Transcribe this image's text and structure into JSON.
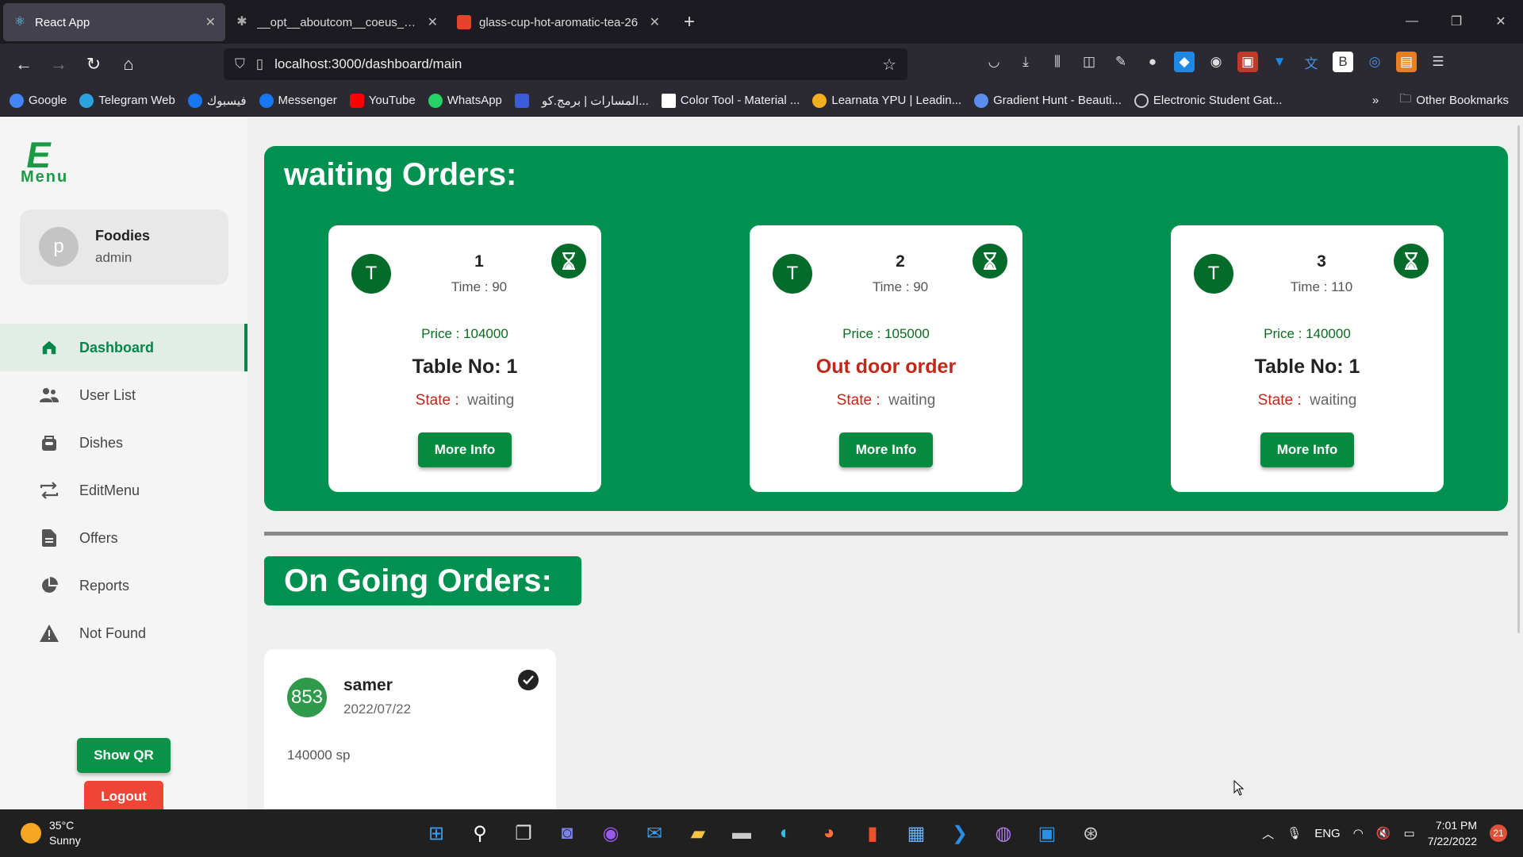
{
  "browser": {
    "tabs": [
      {
        "label": "React App",
        "color": "#61dafb",
        "active": true
      },
      {
        "label": "__opt__aboutcom__coeus__resources",
        "color": "#aaaaaa",
        "active": false
      },
      {
        "label": "glass-cup-hot-aromatic-tea-26",
        "color": "#e8412c",
        "active": false
      }
    ],
    "url": "localhost:3000/dashboard/main",
    "bookmarks": [
      {
        "label": "Google",
        "color": "#4285f4"
      },
      {
        "label": "Telegram Web",
        "color": "#2aa3de"
      },
      {
        "label": "فيسبوك",
        "color": "#1877f2"
      },
      {
        "label": "Messenger",
        "color": "#1877f2"
      },
      {
        "label": "YouTube",
        "color": "#ff0000"
      },
      {
        "label": "WhatsApp",
        "color": "#25d366"
      },
      {
        "label": "",
        "color": "#3b5bdb"
      },
      {
        "label": "المسارات | برمج.كو...",
        "color": "#2b2a33"
      },
      {
        "label": "Color Tool - Material ...",
        "color": "#ffffff"
      },
      {
        "label": "Learnata YPU | Leadin...",
        "color": "#f2b01e"
      },
      {
        "label": "Gradient Hunt - Beauti...",
        "color": "#5b8def"
      },
      {
        "label": "Electronic Student Gat...",
        "color": "#cccccc"
      }
    ],
    "other_bookmarks": "Other Bookmarks"
  },
  "sidebar": {
    "logo_big": "E",
    "logo_small": "Menu",
    "user": {
      "initial": "p",
      "name": "Foodies",
      "role": "admin"
    },
    "items": [
      {
        "label": "Dashboard",
        "icon": "home-icon",
        "active": true
      },
      {
        "label": "User List",
        "icon": "users-icon",
        "active": false
      },
      {
        "label": "Dishes",
        "icon": "dish-icon",
        "active": false
      },
      {
        "label": "EditMenu",
        "icon": "swap-icon",
        "active": false
      },
      {
        "label": "Offers",
        "icon": "document-icon",
        "active": false
      },
      {
        "label": "Reports",
        "icon": "pie-chart-icon",
        "active": false
      },
      {
        "label": "Not Found",
        "icon": "warning-icon",
        "active": false
      }
    ],
    "show_qr": "Show QR",
    "logout": "Logout"
  },
  "waiting": {
    "title": "waiting Orders:",
    "orders": [
      {
        "avatar": "T",
        "number": "1",
        "time": "Time : 90",
        "price": "Price : 104000",
        "table": "Table No: 1",
        "outdoor": false,
        "state_label": "State :",
        "state_value": "waiting",
        "more": "More Info"
      },
      {
        "avatar": "T",
        "number": "2",
        "time": "Time : 90",
        "price": "Price : 105000",
        "table": "Out door order",
        "outdoor": true,
        "state_label": "State :",
        "state_value": "waiting",
        "more": "More Info"
      },
      {
        "avatar": "T",
        "number": "3",
        "time": "Time : 110",
        "price": "Price : 140000",
        "table": "Table No: 1",
        "outdoor": false,
        "state_label": "State :",
        "state_value": "waiting",
        "more": "More Info"
      }
    ]
  },
  "ongoing": {
    "title": "On Going Orders:",
    "orders": [
      {
        "badge": "853",
        "name": "samer",
        "date": "2022/07/22",
        "amount": "140000 sp"
      }
    ]
  },
  "taskbar": {
    "temp": "35°C",
    "weather": "Sunny",
    "lang": "ENG",
    "time": "7:01 PM",
    "date": "7/22/2022",
    "notifications": "21"
  },
  "colors": {
    "primary": "#009150",
    "danger": "#f04436",
    "dark_green": "#056b2a"
  }
}
